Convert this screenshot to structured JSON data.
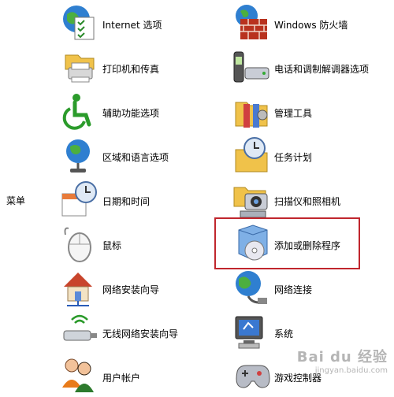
{
  "side_label": "菜单",
  "left_items": [
    {
      "label": "Internet 选项",
      "icon": "internet-options-icon"
    },
    {
      "label": "打印机和传真",
      "icon": "printer-fax-icon"
    },
    {
      "label": "辅助功能选项",
      "icon": "accessibility-icon"
    },
    {
      "label": "区域和语言选项",
      "icon": "region-language-icon"
    },
    {
      "label": "日期和时间",
      "icon": "date-time-icon"
    },
    {
      "label": "鼠标",
      "icon": "mouse-icon"
    },
    {
      "label": "网络安装向导",
      "icon": "network-setup-icon"
    },
    {
      "label": "无线网络安装向导",
      "icon": "wireless-setup-icon"
    },
    {
      "label": "用户帐户",
      "icon": "user-accounts-icon"
    }
  ],
  "right_items": [
    {
      "label": "Windows 防火墙",
      "icon": "firewall-icon"
    },
    {
      "label": "电话和调制解调器选项",
      "icon": "phone-modem-icon"
    },
    {
      "label": "管理工具",
      "icon": "admin-tools-icon"
    },
    {
      "label": "任务计划",
      "icon": "scheduled-tasks-icon"
    },
    {
      "label": "扫描仪和照相机",
      "icon": "scanner-camera-icon"
    },
    {
      "label": "添加或删除程序",
      "icon": "add-remove-programs-icon"
    },
    {
      "label": "网络连接",
      "icon": "network-connections-icon"
    },
    {
      "label": "系统",
      "icon": "system-icon"
    },
    {
      "label": "游戏控制器",
      "icon": "game-controllers-icon"
    }
  ],
  "highlighted_item": "添加或删除程序",
  "watermark": {
    "text": "Bai du 经验",
    "sub": "jingyan.baidu.com"
  },
  "colors": {
    "highlight": "#c0262d"
  }
}
